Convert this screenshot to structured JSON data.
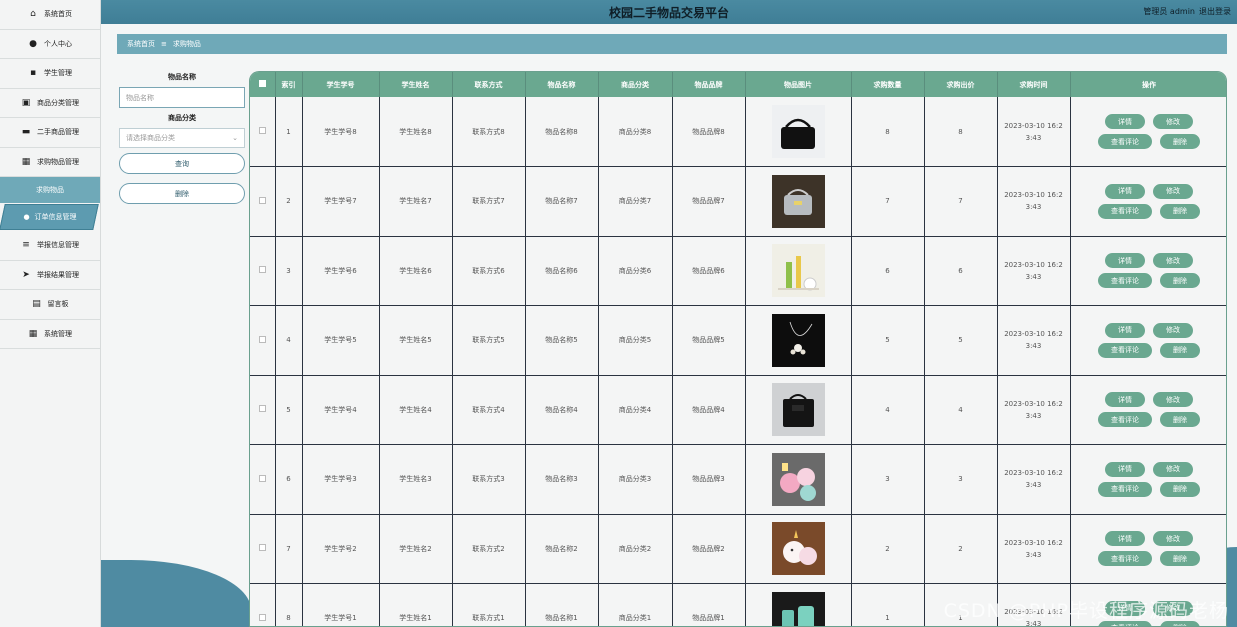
{
  "header": {
    "title": "校园二手物品交易平台",
    "user": "管理员 admin",
    "logout": "退出登录"
  },
  "sidebar": {
    "items": [
      {
        "icon": "home-icon",
        "glyph": "⌂",
        "label": "系统首页"
      },
      {
        "icon": "user-icon",
        "glyph": "●",
        "label": "个人中心"
      },
      {
        "icon": "student-icon",
        "glyph": "▪",
        "label": "学生管理"
      },
      {
        "icon": "category-icon",
        "glyph": "▣",
        "label": "商品分类管理"
      },
      {
        "icon": "goods-icon",
        "glyph": "▬",
        "label": "二手商品管理"
      },
      {
        "icon": "grid-icon",
        "glyph": "▦",
        "label": "求购物品管理"
      }
    ],
    "sub_active": "求购物品",
    "sub2": {
      "icon": "user-icon",
      "label": "订单信息管理"
    },
    "items2": [
      {
        "icon": "list-icon",
        "glyph": "≡",
        "label": "举报信息管理"
      },
      {
        "icon": "send-icon",
        "glyph": "➤",
        "label": "举报结果管理"
      },
      {
        "icon": "board-icon",
        "glyph": "▤",
        "label": "留言板"
      },
      {
        "icon": "grid-icon",
        "glyph": "▦",
        "label": "系统管理"
      }
    ]
  },
  "breadcrumb": {
    "home": "系统首页",
    "sep": "≡",
    "current": "求购物品"
  },
  "search": {
    "name_label": "物品名称",
    "name_placeholder": "物品名称",
    "category_label": "商品分类",
    "category_placeholder": "请选择商品分类",
    "query_button": "查询",
    "delete_button": "删除"
  },
  "table": {
    "headers": [
      "索引",
      "学生学号",
      "学生姓名",
      "联系方式",
      "物品名称",
      "商品分类",
      "物品品牌",
      "物品图片",
      "求购数量",
      "求购出价",
      "求购时间",
      "操作"
    ],
    "buttons": {
      "detail": "详情",
      "edit": "修改",
      "comments": "查看评论",
      "delete": "删除"
    },
    "rows": [
      {
        "idx": "1",
        "sid": "学生学号8",
        "name": "学生姓名8",
        "contact": "联系方式8",
        "item": "物品名称8",
        "cat": "商品分类8",
        "brand": "物品品牌8",
        "img": "handbag",
        "qty": "8",
        "price": "8",
        "time1": "2023-03-10 16:2",
        "time2": "3:43"
      },
      {
        "idx": "2",
        "sid": "学生学号7",
        "name": "学生姓名7",
        "contact": "联系方式7",
        "item": "物品名称7",
        "cat": "商品分类7",
        "brand": "物品品牌7",
        "img": "grey-bag",
        "qty": "7",
        "price": "7",
        "time1": "2023-03-10 16:2",
        "time2": "3:43"
      },
      {
        "idx": "3",
        "sid": "学生学号6",
        "name": "学生姓名6",
        "contact": "联系方式6",
        "item": "物品名称6",
        "cat": "商品分类6",
        "brand": "物品品牌6",
        "img": "cosmetics",
        "qty": "6",
        "price": "6",
        "time1": "2023-03-10 16:2",
        "time2": "3:43"
      },
      {
        "idx": "4",
        "sid": "学生学号5",
        "name": "学生姓名5",
        "contact": "联系方式5",
        "item": "物品名称5",
        "cat": "商品分类5",
        "brand": "物品品牌5",
        "img": "necklace",
        "qty": "5",
        "price": "5",
        "time1": "2023-03-10 16:2",
        "time2": "3:43"
      },
      {
        "idx": "5",
        "sid": "学生学号4",
        "name": "学生姓名4",
        "contact": "联系方式4",
        "item": "物品名称4",
        "cat": "商品分类4",
        "brand": "物品品牌4",
        "img": "black-bag",
        "qty": "4",
        "price": "4",
        "time1": "2023-03-10 16:2",
        "time2": "3:43"
      },
      {
        "idx": "6",
        "sid": "学生学号3",
        "name": "学生姓名3",
        "contact": "联系方式3",
        "item": "物品名称3",
        "cat": "商品分类3",
        "brand": "物品品牌3",
        "img": "plush-pink",
        "qty": "3",
        "price": "3",
        "time1": "2023-03-10 16:2",
        "time2": "3:43"
      },
      {
        "idx": "7",
        "sid": "学生学号2",
        "name": "学生姓名2",
        "contact": "联系方式2",
        "item": "物品名称2",
        "cat": "商品分类2",
        "brand": "物品品牌2",
        "img": "plush-unicorn",
        "qty": "2",
        "price": "2",
        "time1": "2023-03-10 16:2",
        "time2": "3:43"
      },
      {
        "idx": "8",
        "sid": "学生学号1",
        "name": "学生姓名1",
        "contact": "联系方式1",
        "item": "物品名称1",
        "cat": "商品分类1",
        "brand": "物品品牌1",
        "img": "teal-cups",
        "qty": "1",
        "price": "1",
        "time1": "2023-03-10 16:2",
        "time2": "3:43"
      }
    ]
  },
  "watermark": "CSDN @PHP毕设程序源码老杨"
}
